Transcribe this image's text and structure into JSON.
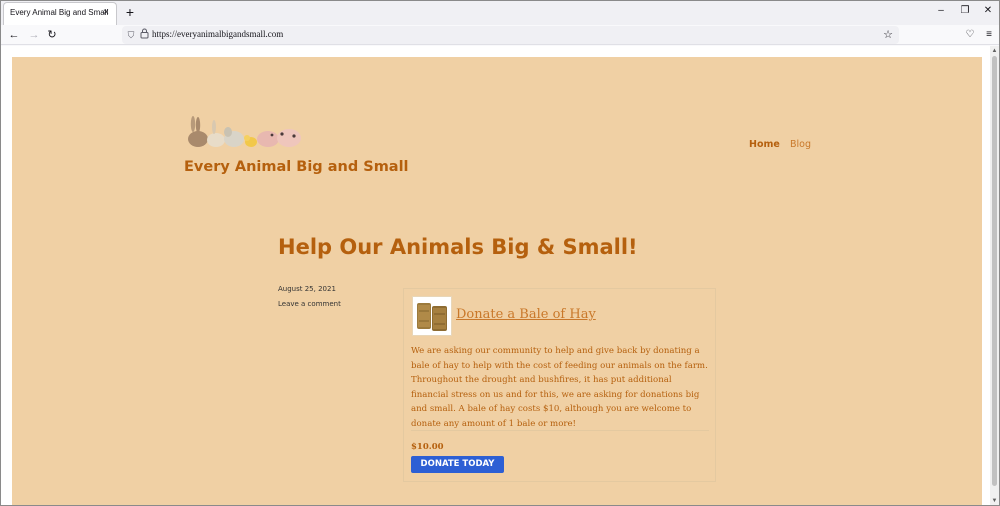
{
  "browser": {
    "tab_title": "Every Animal Big and Small",
    "tab_close": "×",
    "new_tab": "+",
    "window_controls": {
      "minimize": "–",
      "restore": "❐",
      "close": "✕"
    },
    "nav": {
      "back": "←",
      "forward": "→",
      "reload": "↻",
      "star": "☆",
      "pocket": "♡",
      "menu": "≡"
    },
    "url_icons": {
      "shield": "⛉",
      "lock": "🔒"
    },
    "url": "https://everyanimalbigandsmall.com"
  },
  "site": {
    "title": "Every Animal Big and Small",
    "menu": [
      {
        "label": "Home",
        "active": true
      },
      {
        "label": "Blog",
        "active": false
      }
    ],
    "logo_icon": "farm-animals-logo"
  },
  "post": {
    "title": "Help Our Animals Big & Small!",
    "date": "August 25, 2021",
    "comment_link": "Leave a comment"
  },
  "donation": {
    "product_title": "Donate a Bale of Hay",
    "description": "We are asking our community to help and give back by donating a bale of hay to help with the cost of feeding our animals on the farm. Throughout the drought and bushfires, it has put additional financial stress on us and for this, we are asking for donations big and small. A bale of hay costs $10, although you are welcome to donate any amount of 1 bale or more!",
    "price": "$10.00",
    "button_label": "DONATE TODAY",
    "button_color": "#2d5fd4"
  },
  "colors": {
    "page_bg": "#f0d0a4",
    "accent": "#b5600e",
    "link": "#c9782a"
  }
}
